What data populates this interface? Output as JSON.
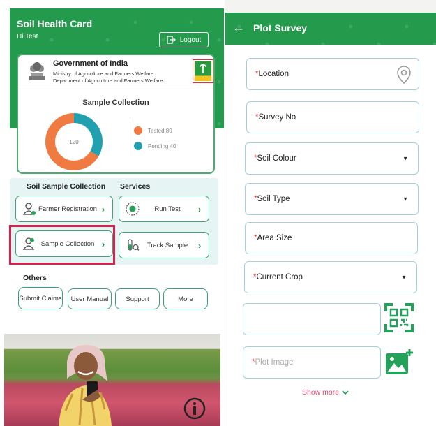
{
  "left_screen": {
    "app_title": "Soil Health Card",
    "greeting": "Hi Test",
    "logout_label": "Logout",
    "gov": {
      "title": "Government of India",
      "ministry": "Ministry of Agriculture and Farmers Welfare",
      "department": "Department of Agriculture and Farmers Welfare"
    },
    "sample_collection": {
      "title": "Sample Collection",
      "total": "120",
      "tested_label": "Tested 80",
      "pending_label": "Pending 40",
      "tested": 80,
      "pending": 40,
      "tested_color": "#f07b42",
      "pending_color": "#22a0b0"
    },
    "section_soil_sample": "Soil Sample Collection",
    "section_services": "Services",
    "services": {
      "farmer_registration": "Farmer Registration",
      "run_test": "Run Test",
      "sample_collection": "Sample Collection",
      "track_sample": "Track Sample"
    },
    "others_label": "Others",
    "others": {
      "submit_claims": "Submit Claims",
      "user_manual": "User Manual",
      "support": "Support",
      "more": "More"
    }
  },
  "right_screen": {
    "title": "Plot Survey",
    "required_mark": "*",
    "fields": {
      "location": "Location",
      "survey_no": "Survey No",
      "soil_colour": "Soil Colour",
      "soil_type": "Soil Type",
      "area_size": "Area Size",
      "current_crop": "Current Crop",
      "plot_image": "Plot Image"
    },
    "show_more": "Show more"
  },
  "colors": {
    "brand_green": "#239a4c",
    "highlight_red": "#d6214e",
    "field_border": "#a5cfdd",
    "show_more_pink": "#e24a6b"
  }
}
